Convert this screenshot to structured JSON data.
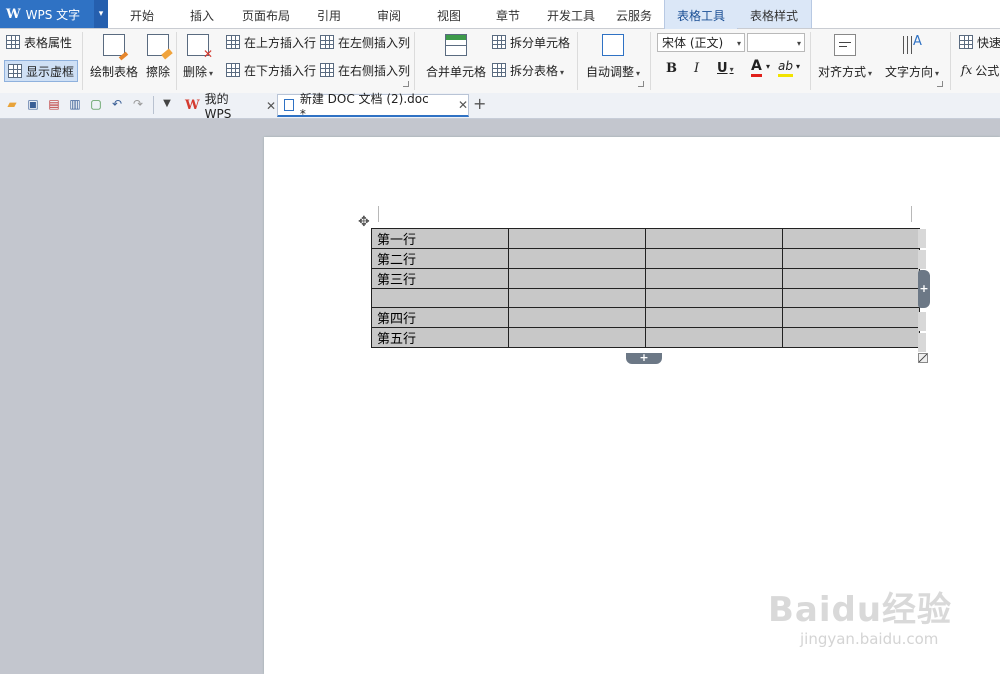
{
  "app": {
    "logo": "W",
    "name": "WPS 文字",
    "drop": "▾"
  },
  "menu_tabs": [
    {
      "label": "开始"
    },
    {
      "label": "插入"
    },
    {
      "label": "页面布局"
    },
    {
      "label": "引用"
    },
    {
      "label": "审阅"
    },
    {
      "label": "视图"
    },
    {
      "label": "章节"
    },
    {
      "label": "开发工具"
    },
    {
      "label": "云服务"
    },
    {
      "label": "表格工具",
      "active": true
    },
    {
      "label": "表格样式"
    }
  ],
  "ribbon": {
    "table_props": "表格属性",
    "show_gridlines": "显示虚框",
    "draw_table": "绘制表格",
    "erase": "擦除",
    "delete": "删除",
    "insert_above": "在上方插入行",
    "insert_below": "在下方插入行",
    "insert_left": "在左侧插入列",
    "insert_right": "在右侧插入列",
    "merge_cells": "合并单元格",
    "split_cells": "拆分单元格",
    "split_table": "拆分表格",
    "auto_fit": "自动调整",
    "font_name": "宋体 (正文)",
    "font_size": "",
    "bold": "B",
    "italic": "I",
    "underline": "U",
    "font_color": "A",
    "highlight": "ab",
    "align": "对齐方式",
    "text_direction": "文字方向",
    "quick_calc": "快速",
    "formula": "公式",
    "fx": "fx"
  },
  "doc_tabs": [
    {
      "label": "我的WPS",
      "close": "✕"
    },
    {
      "label": "新建 DOC 文档 (2).doc *",
      "close": "✕",
      "active": true
    }
  ],
  "new_tab": "+",
  "table": {
    "rows": [
      [
        "第一行",
        "",
        "",
        ""
      ],
      [
        "第二行",
        "",
        "",
        ""
      ],
      [
        "第三行",
        "",
        "",
        ""
      ],
      [
        "",
        "",
        "",
        ""
      ],
      [
        "第四行",
        "",
        "",
        ""
      ],
      [
        "第五行",
        "",
        "",
        ""
      ]
    ]
  },
  "watermark": {
    "brand": "Baidu经验",
    "url": "jingyan.baidu.com"
  },
  "colors": {
    "accent": "#2f72c4",
    "ribbon_bg": "#f7f7f7",
    "workspace": "#c3c6ce",
    "table_fill": "#c8c8c8"
  }
}
